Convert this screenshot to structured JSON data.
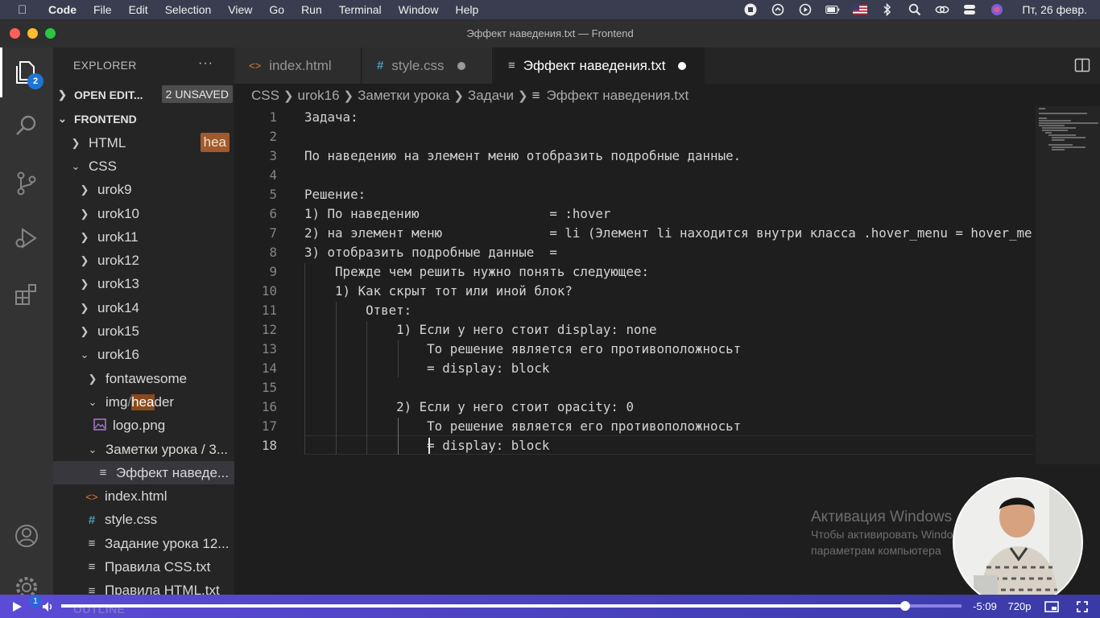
{
  "menubar": {
    "app_name": "Code",
    "items": [
      "File",
      "Edit",
      "Selection",
      "View",
      "Go",
      "Run",
      "Terminal",
      "Window",
      "Help"
    ],
    "date": "Пт, 26 февр."
  },
  "window": {
    "title": "Эффект наведения.txt — Frontend"
  },
  "activity": {
    "explorer_badge": "2"
  },
  "sidebar": {
    "title": "EXPLORER",
    "more": "···",
    "open_editors": {
      "label": "OPEN EDIT...",
      "unsaved": "2 UNSAVED"
    },
    "frontend": {
      "label": "FRONTEND"
    },
    "tree": [
      {
        "label": "HTML",
        "hint": "hea"
      },
      {
        "label": "CSS"
      },
      {
        "label": "urok9"
      },
      {
        "label": "urok10"
      },
      {
        "label": "urok11"
      },
      {
        "label": "urok12"
      },
      {
        "label": "urok13"
      },
      {
        "label": "urok14"
      },
      {
        "label": "urok15"
      },
      {
        "label": "urok16"
      },
      {
        "label": "fontawesome"
      },
      {
        "label_prefix": "img",
        "label_sep": "/",
        "label_hl": "hea",
        "label_rest": "der"
      },
      {
        "label": "logo.png"
      },
      {
        "label": "Заметки урока / 3..."
      },
      {
        "label": "Эффект наведе..."
      },
      {
        "label": "index.html"
      },
      {
        "label": "style.css"
      },
      {
        "label": "Задание урока 12..."
      },
      {
        "label": "Правила CSS.txt"
      },
      {
        "label": "Правила HTML.txt"
      }
    ]
  },
  "tabs": [
    {
      "label": "index.html",
      "icon": "<>"
    },
    {
      "label": "style.css",
      "icon": "#"
    },
    {
      "label": "Эффект наведения.txt",
      "icon": "≡"
    }
  ],
  "breadcrumb": {
    "items": [
      "CSS",
      "urok16",
      "Заметки урока",
      "Задачи"
    ],
    "file": "Эффект наведения.txt"
  },
  "editor": {
    "lines": [
      {
        "n": "1",
        "text": "Задача:"
      },
      {
        "n": "2",
        "text": ""
      },
      {
        "n": "3",
        "text": "По наведению на элемент меню отобразить подробные данные."
      },
      {
        "n": "4",
        "text": ""
      },
      {
        "n": "5",
        "text": "Решение:"
      },
      {
        "n": "6",
        "text": "1) По наведению                 = :hover"
      },
      {
        "n": "7",
        "text": "2) на элемент меню              = li (Элемент li находится внутри класса .hover_menu = hover_me"
      },
      {
        "n": "8",
        "text": "3) отобразить подробные данные  ="
      },
      {
        "n": "9",
        "text": "    Прежде чем решить нужно понять следующее:"
      },
      {
        "n": "10",
        "text": "    1) Как скрыт тот или иной блок?"
      },
      {
        "n": "11",
        "text": "        Ответ:"
      },
      {
        "n": "12",
        "text": "            1) Если у него стоит display: none"
      },
      {
        "n": "13",
        "text": "                То решение является его противоположносьт"
      },
      {
        "n": "14",
        "text": "                = display: block"
      },
      {
        "n": "15",
        "text": ""
      },
      {
        "n": "16",
        "text": "            2) Если у него стоит opacity: 0"
      },
      {
        "n": "17",
        "text": "                То решение является его противоположносьт"
      },
      {
        "n": "18",
        "text": "                = display: block"
      }
    ]
  },
  "watermark": {
    "title": "Активация Windows",
    "line1": "Чтобы активировать Windows, пере",
    "line2": "параметрам компьютера"
  },
  "player": {
    "time": "-5:09",
    "quality": "720p",
    "outline_label": "OUTLINE",
    "volume_badge": "1",
    "progress": 0.937
  },
  "colors": {
    "accent": "#1e74d2",
    "player": "#5b4bd6",
    "hint": "#a05a2c"
  }
}
